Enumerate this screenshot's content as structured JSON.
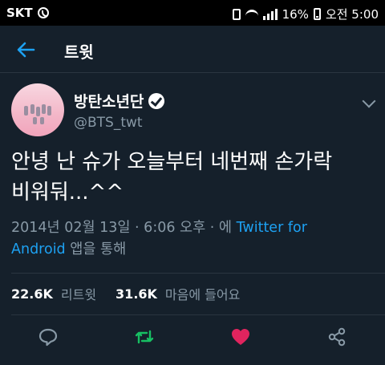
{
  "statusbar": {
    "carrier": "SKT",
    "battery": "16%",
    "time": "오전 5:00"
  },
  "appbar": {
    "title": "트윗"
  },
  "tweet": {
    "display_name": "방탄소년단",
    "handle": "@BTS_twt",
    "text_line1": "안녕 난 슈가 오늘부터 네번째 손가락",
    "text_line2": "비워둬...^^",
    "date": "2014년 02월 13일 · 6:06 오후 · 에 ",
    "source_part1": "Twitter for",
    "source_part2": "Android",
    "source_suffix": " 앱을 통해"
  },
  "stats": {
    "retweets": "22.6K",
    "retweets_label": "리트윗",
    "likes": "31.6K",
    "likes_label": "마음에 들어요"
  },
  "colors": {
    "accent": "#1da1f2",
    "retweet": "#17bf63",
    "like": "#e0245e",
    "bg": "#15202b"
  },
  "icons": [
    "back-arrow-icon",
    "verified-icon",
    "chevron-down-icon",
    "reply-icon",
    "retweet-icon",
    "heart-icon",
    "share-icon"
  ]
}
